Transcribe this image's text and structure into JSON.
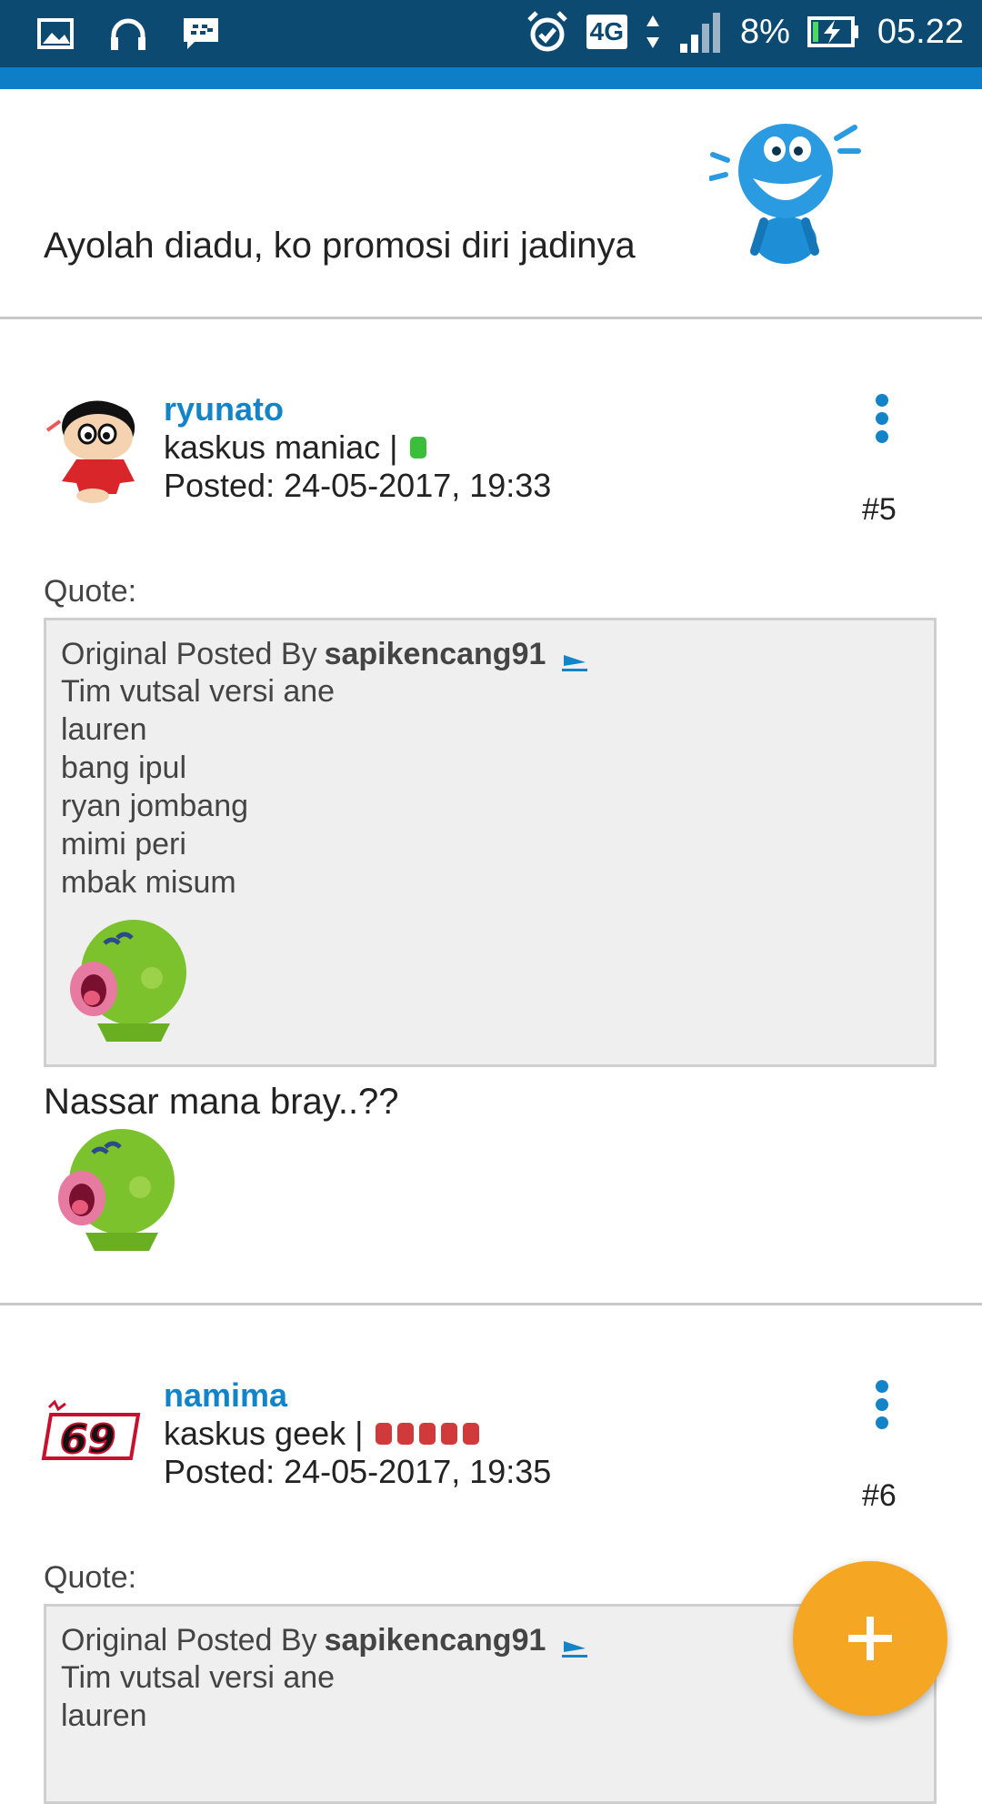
{
  "status_bar": {
    "network": "4G",
    "battery": "8%",
    "time": "05.22"
  },
  "previous_post": {
    "tail_text": "Ayolah diadu, ko promosi diri jadinya"
  },
  "posts": [
    {
      "username": "ryunato",
      "rank": "kaskus maniac |",
      "posted": "Posted: 24-05-2017, 19:33",
      "number": "#5",
      "quote_label": "Quote:",
      "quote_prefix": "Original Posted By",
      "quote_author": "sapikencang91",
      "quote_lines": [
        "Tim vutsal versi ane",
        "lauren",
        "bang ipul",
        "ryan jombang",
        "mimi peri",
        "mbak misum"
      ],
      "body": "Nassar mana bray..??"
    },
    {
      "username": "namima",
      "rank": "kaskus geek |",
      "posted": "Posted: 24-05-2017, 19:35",
      "number": "#6",
      "quote_label": "Quote:",
      "quote_prefix": "Original Posted By",
      "quote_author": "sapikencang91",
      "quote_lines": [
        "Tim vutsal versi ane",
        "lauren"
      ]
    }
  ],
  "colors": {
    "accent": "#1284c7",
    "fab": "#f5a623",
    "status_bar": "#0c4a72"
  }
}
